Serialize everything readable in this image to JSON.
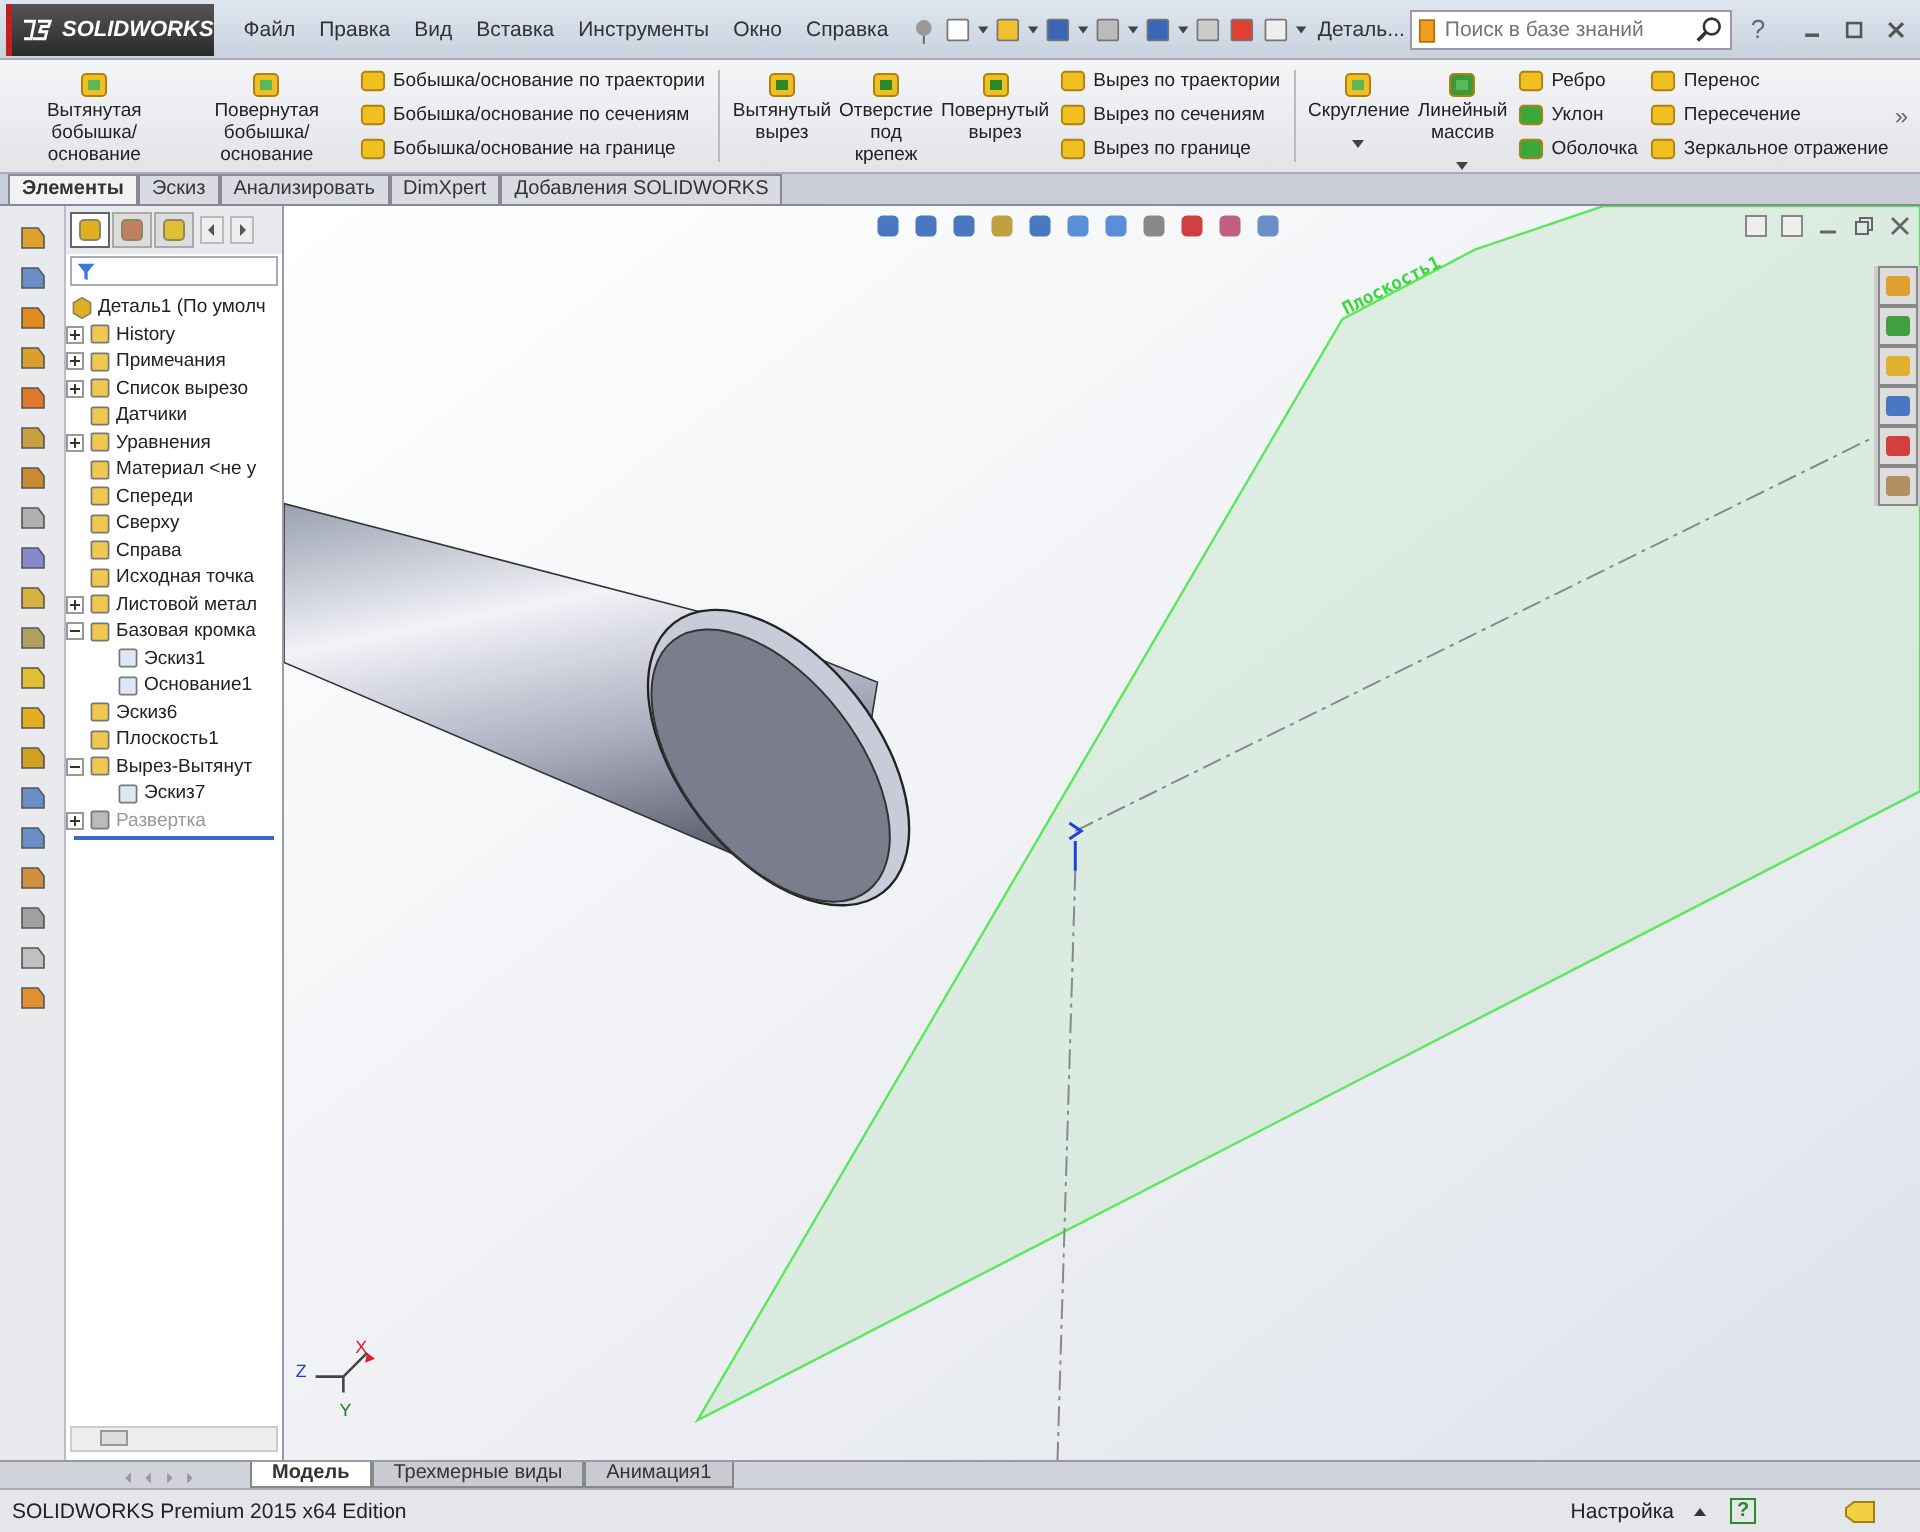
{
  "titlebar": {
    "logo": "SOLIDWORKS",
    "menu": [
      "Файл",
      "Правка",
      "Вид",
      "Вставка",
      "Инструменты",
      "Окно",
      "Справка"
    ],
    "document": "Деталь...",
    "search": {
      "placeholder": "Поиск в базе знаний"
    },
    "help": "?"
  },
  "ribbon": {
    "groups": [
      {
        "large": [
          {
            "label": "Вытянутая\nбобышка/основание",
            "dropdown": false
          },
          {
            "label": "Повернутая\nбобышка/основание",
            "dropdown": false
          }
        ],
        "small_columns": [
          [
            "Бобышка/основание по траектории",
            "Бобышка/основание по сечениям",
            "Бобышка/основание на границе"
          ]
        ]
      },
      {
        "large": [
          {
            "label": "Вытянутый\nвырез",
            "dropdown": false
          },
          {
            "label": "Отверстие\nпод\nкрепеж",
            "dropdown": false
          },
          {
            "label": "Повернутый\nвырез",
            "dropdown": false
          }
        ],
        "small_columns": [
          [
            "Вырез по траектории",
            "Вырез по сечениям",
            "Вырез по границе"
          ]
        ]
      },
      {
        "large": [
          {
            "label": "Скругление",
            "dropdown": true
          },
          {
            "label": "Линейный\nмассив",
            "dropdown": true
          }
        ],
        "small_columns": [
          [
            "Ребро",
            "Уклон",
            "Оболочка"
          ],
          [
            "Перенос",
            "Пересечение",
            "Зеркальное отражение"
          ]
        ]
      }
    ],
    "overflow": "»"
  },
  "command_tabs": [
    {
      "label": "Элементы",
      "selected": true
    },
    {
      "label": "Эскиз",
      "selected": false
    },
    {
      "label": "Анализировать",
      "selected": false
    },
    {
      "label": "DimXpert",
      "selected": false
    },
    {
      "label": "Добавления SOLIDWORKS",
      "selected": false
    }
  ],
  "feature_tree": {
    "panel_tabs": [
      {
        "selected": true
      },
      {
        "selected": false
      },
      {
        "selected": false
      }
    ],
    "root": {
      "label": "Деталь1  (По умолч",
      "children": [
        {
          "label": "History",
          "expanded": false
        },
        {
          "label": "Примечания",
          "expanded": false
        },
        {
          "label": "Список вырезо",
          "expanded": false
        },
        {
          "label": "Датчики"
        },
        {
          "label": "Уравнения",
          "expanded": false
        },
        {
          "label": "Материал <не у"
        },
        {
          "label": "Спереди"
        },
        {
          "label": "Сверху"
        },
        {
          "label": "Справа"
        },
        {
          "label": "Исходная точка"
        },
        {
          "label": "Листовой метал",
          "expanded": false
        },
        {
          "label": "Базовая кромка",
          "expanded": true,
          "children": [
            {
              "label": "Эскиз1"
            },
            {
              "label": "Основание1"
            }
          ]
        },
        {
          "label": "Эскиз6"
        },
        {
          "label": "Плоскость1"
        },
        {
          "label": "Вырез-Вытянут",
          "expanded": true,
          "children": [
            {
              "label": "Эскиз7"
            }
          ]
        },
        {
          "label": "Развертка",
          "expanded": false,
          "suppressed": true
        }
      ]
    }
  },
  "viewport": {
    "plane_label": "Плоскость1",
    "triad": {
      "x": "X",
      "y": "Y",
      "z": "Z"
    }
  },
  "bottom_tabs": [
    {
      "label": "Модель",
      "selected": true
    },
    {
      "label": "Трехмерные виды",
      "selected": false
    },
    {
      "label": "Анимация1",
      "selected": false
    }
  ],
  "status_bar": {
    "text": "SOLIDWORKS Premium 2015 x64 Edition",
    "units": "Настройка",
    "help": "?"
  }
}
